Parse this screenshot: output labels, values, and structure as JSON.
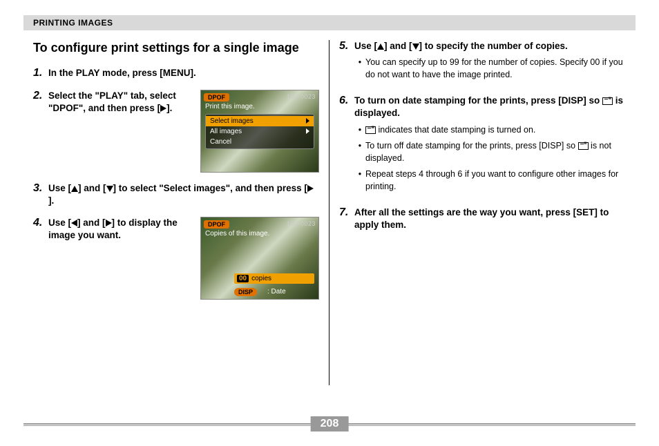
{
  "header": "PRINTING IMAGES",
  "sectionTitle": "To configure print settings for a single image",
  "pageNumber": "208",
  "glyphs": {
    "up": "▲",
    "down": "▼",
    "left": "◀",
    "right": "▶"
  },
  "steps": {
    "s1": {
      "num": "1.",
      "text_a": "In the PLAY mode, press [MENU]."
    },
    "s2": {
      "num": "2.",
      "text_a": "Select the \"PLAY\" tab, select \"DPOF\", and then press [",
      "text_b": "]."
    },
    "s3": {
      "num": "3.",
      "text_a": "Use [",
      "text_b": "] and [",
      "text_c": "] to select \"Select images\", and then press [",
      "text_d": "]."
    },
    "s4": {
      "num": "4.",
      "text_a": "Use [",
      "text_b": "] and [",
      "text_c": "] to display the image you want."
    },
    "s5": {
      "num": "5.",
      "text_a": "Use [",
      "text_b": "] and [",
      "text_c": "] to specify the number of copies.",
      "bullet1": "You can specify up to 99 for the number of copies. Specify 00 if you do not want to have the image printed."
    },
    "s6": {
      "num": "6.",
      "text_a": "To turn on date stamping for the prints, press [DISP] so ",
      "text_b": " is displayed.",
      "bullet1_a": "",
      "bullet1_b": " indicates that date stamping is turned on.",
      "bullet2_a": "To turn off date stamping for the prints, press [DISP] so ",
      "bullet2_b": " is not displayed.",
      "bullet3": "Repeat steps 4 through 6 if you want to configure other images for printing."
    },
    "s7": {
      "num": "7.",
      "text_a": "After all the settings are the way you want, press [SET] to apply them."
    }
  },
  "cam1": {
    "tag": "DPOF",
    "frame": "100-0023",
    "title": "Print this image.",
    "items": [
      "Select images",
      "All images",
      "Cancel"
    ]
  },
  "cam2": {
    "tag": "DPOF",
    "frame": "100-0023",
    "title": "Copies of this image.",
    "copiesNum": "00",
    "copiesLabel": "copies",
    "disp": "DISP",
    "dateLabel": ": Date"
  }
}
